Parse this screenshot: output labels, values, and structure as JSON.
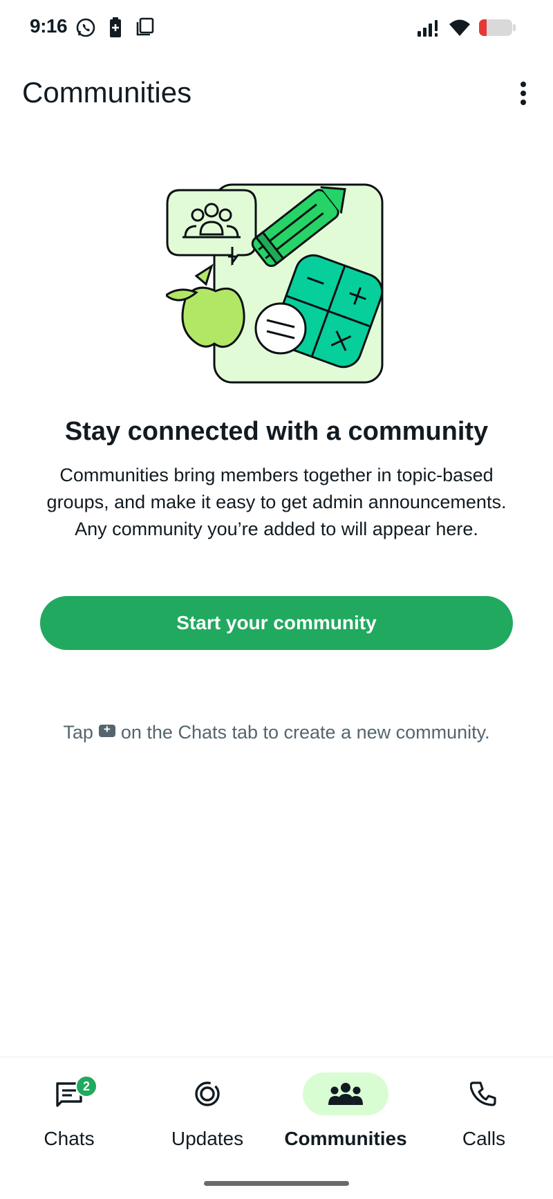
{
  "status_bar": {
    "time": "9:16",
    "icons": [
      "whatsapp-icon",
      "battery-saver-icon",
      "screenshot-icon",
      "signal-icon",
      "wifi-icon",
      "battery-icon"
    ],
    "battery_color": "#e53935"
  },
  "header": {
    "title": "Communities",
    "more_icon": "more-vertical-icon"
  },
  "empty_state": {
    "heading": "Stay connected with a community",
    "description_lines": [
      "Communities bring members together in topic-based",
      "groups, and make it easy to get admin announcements.",
      "Any community you’re added to will appear here."
    ],
    "button_label": "Start your community",
    "tip_before": "Tap",
    "tip_icon": "new-community-icon",
    "tip_after": "on the Chats tab to create a new community."
  },
  "nav": {
    "items": [
      {
        "label": "Chats",
        "icon": "chats-icon",
        "badge": "2",
        "active": false
      },
      {
        "label": "Updates",
        "icon": "updates-icon",
        "active": false
      },
      {
        "label": "Communities",
        "icon": "communities-icon",
        "active": true
      },
      {
        "label": "Calls",
        "icon": "calls-icon",
        "active": false
      }
    ]
  },
  "colors": {
    "accent": "#21a95f",
    "active_nav_bg": "#d8fdd2",
    "text_primary": "#111b21",
    "text_secondary": "#54656f"
  }
}
